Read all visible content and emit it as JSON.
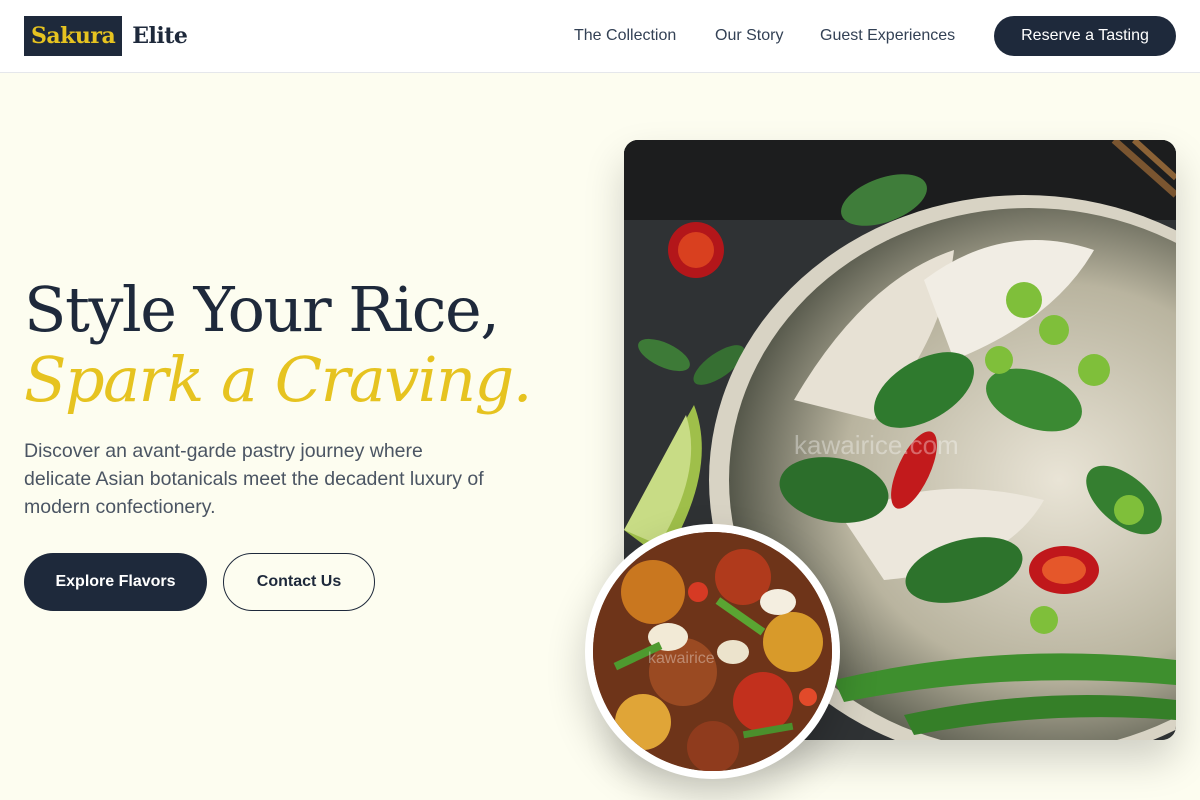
{
  "header": {
    "logo_primary": "Sakura",
    "logo_secondary": "Elite",
    "nav": [
      "The Collection",
      "Our Story",
      "Guest Experiences"
    ],
    "cta_label": "Reserve a Tasting"
  },
  "hero": {
    "title_line1": "Style Your Rice,",
    "title_line2": "Spark a Craving.",
    "description": "Discover an avant-garde pastry journey where delicate Asian botanicals meet the decadent luxury of modern confectionery.",
    "primary_button": "Explore Flavors",
    "secondary_button": "Contact Us"
  },
  "images": {
    "main_watermark": "kawairice.com",
    "thumb_watermark": "kawairice"
  },
  "colors": {
    "navy": "#1e293b",
    "gold": "#e6c320",
    "cream": "#fdfdf0"
  },
  "icons": [
    "noodle-bowl-photo",
    "stir-fry-photo"
  ]
}
